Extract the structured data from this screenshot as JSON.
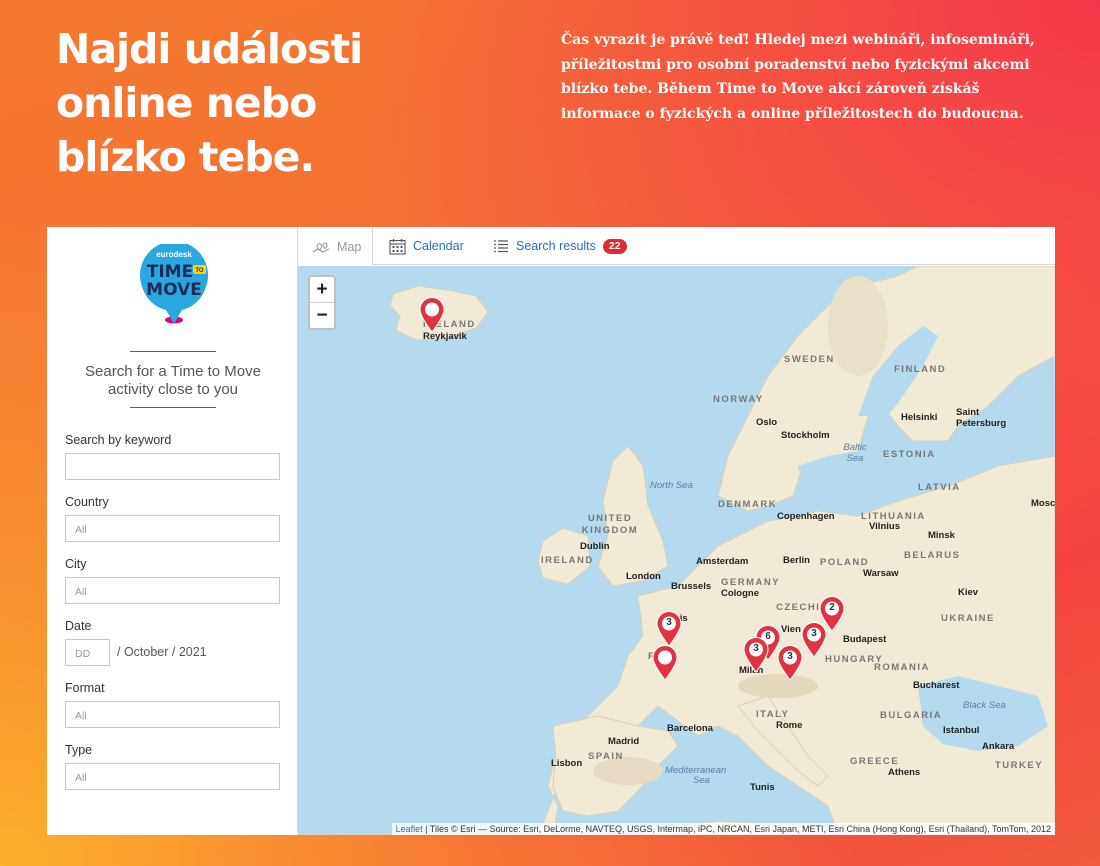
{
  "hero": {
    "headline_lines": [
      "Najdi události",
      "online nebo",
      "blízko tebe."
    ],
    "intro": "Čas vyrazit je právě teď! Hledej mezi webináři, infosemináři, příležitostmi pro osobní poradenství nebo fyzickými akcemi blízko tebe. Během Time to Move akcí zároveň získáš informace o fyzických a online příležitostech do budoucna."
  },
  "sidebar": {
    "logo": {
      "brand": "eurodesk",
      "line1": "TIME",
      "to": "TO",
      "line2": "MOVE"
    },
    "tagline": "Search for a Time to Move activity close to you",
    "filters": {
      "keyword": {
        "label": "Search by keyword",
        "value": ""
      },
      "country": {
        "label": "Country",
        "placeholder": "All"
      },
      "city": {
        "label": "City",
        "placeholder": "All"
      },
      "date": {
        "label": "Date",
        "placeholder": "DD",
        "rest": "/ October / 2021"
      },
      "format": {
        "label": "Format",
        "placeholder": "All"
      },
      "type": {
        "label": "Type",
        "placeholder": "All"
      }
    }
  },
  "tabs": [
    {
      "label": "Map",
      "icon": "map-icon",
      "active": true
    },
    {
      "label": "Calendar",
      "icon": "calendar-icon",
      "active": false
    },
    {
      "label": "Search results",
      "icon": "list-icon",
      "badge": "22",
      "active": false
    }
  ],
  "map": {
    "zoom_in": "+",
    "zoom_out": "−",
    "labels": {
      "iceland": "ICELAND",
      "reykjavik": "Reykjavik",
      "sweden": "SWEDEN",
      "finland": "FINLAND",
      "norway": "NORWAY",
      "helsinki": "Helsinki",
      "saint_petersburg": "Saint Petersburg",
      "oslo": "Oslo",
      "stockholm": "Stockholm",
      "baltic_sea": "Baltic Sea",
      "estonia": "ESTONIA",
      "north_sea": "North Sea",
      "latvia": "LATVIA",
      "moscow": "Mosco",
      "denmark": "DENMARK",
      "united_kingdom": "UNITED KINGDOM",
      "copenhagen": "Copenhagen",
      "lithuania": "LITHUANIA",
      "vilnius": "Vilnius",
      "dublin": "Dublin",
      "ireland": "IRELAND",
      "amsterdam": "Amsterdam",
      "berlin": "Berlin",
      "minsk": "Minsk",
      "belarus": "BELARUS",
      "london": "London",
      "poland": "POLAND",
      "warsaw": "Warsaw",
      "brussels": "Brussels",
      "germany": "GERMANY",
      "cologne": "Cologne",
      "kiev": "Kiev",
      "paris": "ris",
      "czechia": "CZECHIA",
      "ukraine": "UKRAINE",
      "vienna": "Vien",
      "budapest": "Budapest",
      "france": "F    CE",
      "hungary": "HUNGARY",
      "romania": "ROMANIA",
      "milan": "Milan",
      "bucharest": "Bucharest",
      "italy": "ITALY",
      "barcelona": "Barcelona",
      "rome": "Rome",
      "black_sea": "Black Sea",
      "bulgaria": "BULGARIA",
      "madrid": "Madrid",
      "spain": "SPAIN",
      "istanbul": "Istanbul",
      "ankara": "Ankara",
      "lisbon": "Lisbon",
      "turkey": "TURKEY",
      "greece": "GREECE",
      "mediterranean": "Mediterranean",
      "sea": "Sea",
      "athens": "Athens",
      "tunis": "Tunis"
    },
    "markers": [
      {
        "id": "reykjavik",
        "count": ""
      },
      {
        "id": "paris",
        "count": "3"
      },
      {
        "id": "france",
        "count": ""
      },
      {
        "id": "slovakia",
        "count": "2"
      },
      {
        "id": "austria",
        "count": "6"
      },
      {
        "id": "hungary",
        "count": "3"
      },
      {
        "id": "milan",
        "count": "3"
      },
      {
        "id": "slovenia",
        "count": "3"
      }
    ],
    "attribution_link": "Leaflet",
    "attribution": " | Tiles © Esri — Source: Esri, DeLorme, NAVTEQ, USGS, Intermap, iPC, NRCAN, Esri Japan, METI, Esri China (Hong Kong), Esri (Thailand), TomTom, 2012"
  },
  "colors": {
    "accent": "#d82b33",
    "link": "#2d6ea8",
    "land": "#f1ead6",
    "water": "#b5daee"
  }
}
